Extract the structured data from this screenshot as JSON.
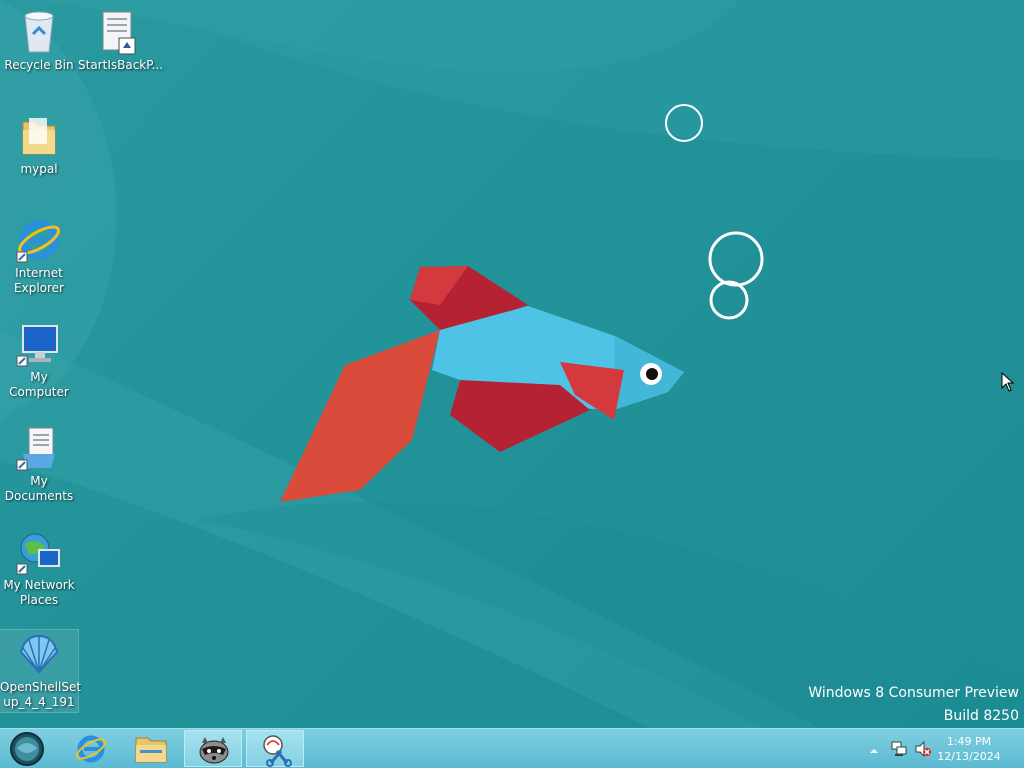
{
  "desktop_icons": [
    {
      "label": "Recycle Bin",
      "icon": "recycle-bin-icon"
    },
    {
      "label": "StartIsBackP...",
      "icon": "installer-document-icon"
    },
    {
      "label": "mypal",
      "icon": "folder-icon"
    },
    {
      "label": "Internet Explorer",
      "icon": "internet-explorer-icon"
    },
    {
      "label": "My Computer",
      "icon": "computer-icon"
    },
    {
      "label": "My Documents",
      "icon": "documents-icon"
    },
    {
      "label": "My Network Places",
      "icon": "network-places-icon"
    },
    {
      "label": "OpenShellSetup_4_4_191",
      "icon": "shell-icon"
    }
  ],
  "desktop_icon_labels": {
    "ie_line1": "Internet",
    "ie_line2": "Explorer",
    "docs_line1": "My",
    "docs_line2": "Documents",
    "net_line1": "My Network",
    "net_line2": "Places",
    "shell_line1": "OpenShellSet",
    "shell_line2": "up_4_4_191"
  },
  "watermark": {
    "line1": "Windows 8 Consumer Preview",
    "line2": "Build 8250"
  },
  "taskbar": {
    "buttons": [
      {
        "icon": "start-orb-icon"
      },
      {
        "icon": "internet-explorer-icon"
      },
      {
        "icon": "file-explorer-icon"
      },
      {
        "icon": "raccoon-app-icon",
        "active": true
      },
      {
        "icon": "snipping-tool-icon",
        "active": true
      }
    ]
  },
  "tray": {
    "time": "1:49 PM",
    "date": "12/13/2024",
    "icons": [
      "show-hidden-icons-chevron",
      "network-icon",
      "volume-muted-icon"
    ]
  },
  "colors": {
    "wallpaper": "#23939a",
    "taskbar": "#6cc4da",
    "fish_body": "#4fc3e6",
    "fish_fin_dark": "#b52233",
    "fish_fin_orange": "#d94b3a"
  }
}
